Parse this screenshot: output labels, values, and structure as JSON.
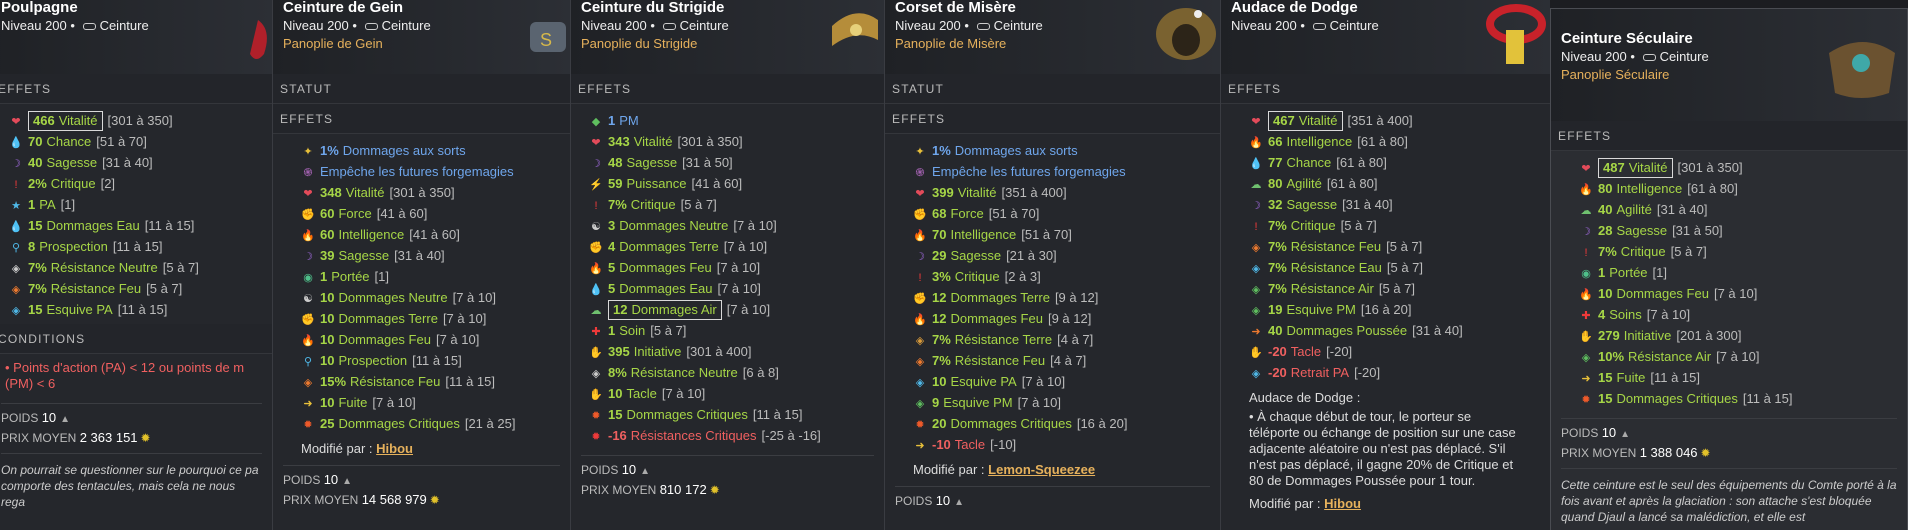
{
  "panels": [
    {
      "name": "Poulpagne",
      "level": "Niveau 200",
      "type": "Ceinture",
      "effects_label": "EFFETS",
      "effects": [
        {
          "i": "❤",
          "c": "#e34b5a",
          "v": "466",
          "t": "Vitalité",
          "r": "[301 à 350]",
          "box": true,
          "cl": "g"
        },
        {
          "i": "💧",
          "c": "#56b3ea",
          "v": "70",
          "t": "Chance",
          "r": "[51 à 70]",
          "cl": "g"
        },
        {
          "i": "☽",
          "c": "#a26be0",
          "v": "40",
          "t": "Sagesse",
          "r": "[31 à 40]",
          "cl": "g"
        },
        {
          "i": "!",
          "c": "#ef3a3a",
          "v": "2%",
          "t": "Critique",
          "r": "[2]",
          "cl": "g"
        },
        {
          "i": "★",
          "c": "#4fb8e8",
          "v": "1",
          "t": "PA",
          "r": "[1]",
          "cl": "g"
        },
        {
          "i": "💧",
          "c": "#56b3ea",
          "v": "15",
          "t": "Dommages Eau",
          "r": "[11 à 15]",
          "cl": "g"
        },
        {
          "i": "⚲",
          "c": "#4fb8e8",
          "v": "8",
          "t": "Prospection",
          "r": "[11 à 15]",
          "cl": "g"
        },
        {
          "i": "◈",
          "c": "#ccc",
          "v": "7%",
          "t": "Résistance Neutre",
          "r": "[5 à 7]",
          "cl": "g"
        },
        {
          "i": "◈",
          "c": "#ee7a2f",
          "v": "7%",
          "t": "Résistance Feu",
          "r": "[5 à 7]",
          "cl": "g"
        },
        {
          "i": "◈",
          "c": "#4fb8e8",
          "v": "15",
          "t": "Esquive PA",
          "r": "[11 à 15]",
          "cl": "g"
        }
      ],
      "conditions_label": "CONDITIONS",
      "conditions": "• Points d'action (PA) < 12 ou points de m (PM) < 6",
      "weight_label": "POIDS",
      "weight": "10",
      "price_label": "PRIX MOYEN",
      "price": "2 363 151",
      "description": "On pourrait se questionner sur le pourquoi ce pa comporte des tentacules, mais cela ne nous rega"
    },
    {
      "name": "Ceinture de Gein",
      "level": "Niveau 200",
      "type": "Ceinture",
      "set": "Panoplie de Gein",
      "status_label": "STATUT",
      "effects_label": "EFFETS",
      "effects": [
        {
          "i": "✦",
          "c": "#e8c03a",
          "v": "1%",
          "t": "Dommages aux sorts",
          "cl": "b"
        },
        {
          "i": "֍",
          "c": "#c070d0",
          "v": "",
          "t": "Empêche les futures forgemagies",
          "cl": "b"
        },
        {
          "i": "❤",
          "c": "#e34b5a",
          "v": "348",
          "t": "Vitalité",
          "r": "[301 à 350]",
          "cl": "g"
        },
        {
          "i": "✊",
          "c": "#d89a3a",
          "v": "60",
          "t": "Force",
          "r": "[41 à 60]",
          "cl": "g"
        },
        {
          "i": "🔥",
          "c": "#ee7a2f",
          "v": "60",
          "t": "Intelligence",
          "r": "[41 à 60]",
          "cl": "g"
        },
        {
          "i": "☽",
          "c": "#a26be0",
          "v": "39",
          "t": "Sagesse",
          "r": "[31 à 40]",
          "cl": "g"
        },
        {
          "i": "◉",
          "c": "#4fc08a",
          "v": "1",
          "t": "Portée",
          "r": "[1]",
          "cl": "g"
        },
        {
          "i": "☯",
          "c": "#ccc",
          "v": "10",
          "t": "Dommages Neutre",
          "r": "[7 à 10]",
          "cl": "g"
        },
        {
          "i": "✊",
          "c": "#d89a3a",
          "v": "10",
          "t": "Dommages Terre",
          "r": "[7 à 10]",
          "cl": "g"
        },
        {
          "i": "🔥",
          "c": "#ee7a2f",
          "v": "10",
          "t": "Dommages Feu",
          "r": "[7 à 10]",
          "cl": "g"
        },
        {
          "i": "⚲",
          "c": "#4fb8e8",
          "v": "10",
          "t": "Prospection",
          "r": "[11 à 15]",
          "cl": "g"
        },
        {
          "i": "◈",
          "c": "#ee7a2f",
          "v": "15%",
          "t": "Résistance Feu",
          "r": "[11 à 15]",
          "cl": "g"
        },
        {
          "i": "➜",
          "c": "#e8c03a",
          "v": "10",
          "t": "Fuite",
          "r": "[7 à 10]",
          "cl": "g"
        },
        {
          "i": "✹",
          "c": "#ef5a2a",
          "v": "25",
          "t": "Dommages Critiques",
          "r": "[21 à 25]",
          "cl": "g"
        }
      ],
      "modified_label": "Modifié par :",
      "modified_by": "Hibou",
      "weight_label": "POIDS",
      "weight": "10",
      "price_label": "PRIX MOYEN",
      "price": "14 568 979"
    },
    {
      "name": "Ceinture du Strigide",
      "level": "Niveau 200",
      "type": "Ceinture",
      "set": "Panoplie du Strigide",
      "effects_label": "EFFETS",
      "effects": [
        {
          "i": "◆",
          "c": "#5fbf5f",
          "v": "1",
          "t": "PM",
          "cl": "b"
        },
        {
          "i": "❤",
          "c": "#e34b5a",
          "v": "343",
          "t": "Vitalité",
          "r": "[301 à 350]",
          "cl": "g"
        },
        {
          "i": "☽",
          "c": "#a26be0",
          "v": "48",
          "t": "Sagesse",
          "r": "[31 à 50]",
          "cl": "g"
        },
        {
          "i": "⚡",
          "c": "#e8c03a",
          "v": "59",
          "t": "Puissance",
          "r": "[41 à 60]",
          "cl": "g"
        },
        {
          "i": "!",
          "c": "#ef3a3a",
          "v": "7%",
          "t": "Critique",
          "r": "[5 à 7]",
          "cl": "g"
        },
        {
          "i": "☯",
          "c": "#ccc",
          "v": "3",
          "t": "Dommages Neutre",
          "r": "[7 à 10]",
          "cl": "g"
        },
        {
          "i": "✊",
          "c": "#d89a3a",
          "v": "4",
          "t": "Dommages Terre",
          "r": "[7 à 10]",
          "cl": "g"
        },
        {
          "i": "🔥",
          "c": "#ee7a2f",
          "v": "5",
          "t": "Dommages Feu",
          "r": "[7 à 10]",
          "cl": "g"
        },
        {
          "i": "💧",
          "c": "#56b3ea",
          "v": "5",
          "t": "Dommages Eau",
          "r": "[7 à 10]",
          "cl": "g"
        },
        {
          "i": "☁",
          "c": "#6fc06f",
          "v": "12",
          "t": "Dommages Air",
          "r": "[7 à 10]",
          "box": true,
          "cl": "g"
        },
        {
          "i": "✚",
          "c": "#ef3a3a",
          "v": "1",
          "t": "Soin",
          "r": "[5 à 7]",
          "cl": "g"
        },
        {
          "i": "✋",
          "c": "#c070d0",
          "v": "395",
          "t": "Initiative",
          "r": "[301 à 400]",
          "cl": "g"
        },
        {
          "i": "◈",
          "c": "#ccc",
          "v": "8%",
          "t": "Résistance Neutre",
          "r": "[6 à 8]",
          "cl": "g"
        },
        {
          "i": "✋",
          "c": "#ccc",
          "v": "10",
          "t": "Tacle",
          "r": "[7 à 10]",
          "cl": "g"
        },
        {
          "i": "✹",
          "c": "#ef5a2a",
          "v": "15",
          "t": "Dommages Critiques",
          "r": "[11 à 15]",
          "cl": "g"
        },
        {
          "i": "✹",
          "c": "#ef3a3a",
          "v": "-16",
          "t": "Résistances Critiques",
          "r": "[-25 à -16]",
          "cl": "r"
        }
      ],
      "weight_label": "POIDS",
      "weight": "10",
      "price_label": "PRIX MOYEN",
      "price": "810 172"
    },
    {
      "name": "Corset de Misère",
      "level": "Niveau 200",
      "type": "Ceinture",
      "set": "Panoplie de Misère",
      "status_label": "STATUT",
      "effects_label": "EFFETS",
      "effects": [
        {
          "i": "✦",
          "c": "#e8c03a",
          "v": "1%",
          "t": "Dommages aux sorts",
          "cl": "b"
        },
        {
          "i": "֍",
          "c": "#c070d0",
          "v": "",
          "t": "Empêche les futures forgemagies",
          "cl": "b"
        },
        {
          "i": "❤",
          "c": "#e34b5a",
          "v": "399",
          "t": "Vitalité",
          "r": "[351 à 400]",
          "cl": "g"
        },
        {
          "i": "✊",
          "c": "#d89a3a",
          "v": "68",
          "t": "Force",
          "r": "[51 à 70]",
          "cl": "g"
        },
        {
          "i": "🔥",
          "c": "#ee7a2f",
          "v": "70",
          "t": "Intelligence",
          "r": "[51 à 70]",
          "cl": "g"
        },
        {
          "i": "☽",
          "c": "#a26be0",
          "v": "29",
          "t": "Sagesse",
          "r": "[21 à 30]",
          "cl": "g"
        },
        {
          "i": "!",
          "c": "#ef3a3a",
          "v": "3%",
          "t": "Critique",
          "r": "[2 à 3]",
          "cl": "g"
        },
        {
          "i": "✊",
          "c": "#d89a3a",
          "v": "12",
          "t": "Dommages Terre",
          "r": "[9 à 12]",
          "cl": "g"
        },
        {
          "i": "🔥",
          "c": "#ee7a2f",
          "v": "12",
          "t": "Dommages Feu",
          "r": "[9 à 12]",
          "cl": "g"
        },
        {
          "i": "◈",
          "c": "#d89a3a",
          "v": "7%",
          "t": "Résistance Terre",
          "r": "[4 à 7]",
          "cl": "g"
        },
        {
          "i": "◈",
          "c": "#ee7a2f",
          "v": "7%",
          "t": "Résistance Feu",
          "r": "[4 à 7]",
          "cl": "g"
        },
        {
          "i": "◈",
          "c": "#4fb8e8",
          "v": "10",
          "t": "Esquive PA",
          "r": "[7 à 10]",
          "cl": "g"
        },
        {
          "i": "◈",
          "c": "#5fbf5f",
          "v": "9",
          "t": "Esquive PM",
          "r": "[7 à 10]",
          "cl": "g"
        },
        {
          "i": "✹",
          "c": "#ef5a2a",
          "v": "20",
          "t": "Dommages Critiques",
          "r": "[16 à 20]",
          "cl": "g"
        },
        {
          "i": "➜",
          "c": "#e8c03a",
          "v": "-10",
          "t": "Tacle",
          "r": "[-10]",
          "cl": "r"
        }
      ],
      "modified_label": "Modifié par :",
      "modified_by": "Lemon-Squeezee",
      "weight_label": "POIDS",
      "weight": "10"
    },
    {
      "name": "Audace de Dodge",
      "level": "Niveau 200",
      "type": "Ceinture",
      "effects_label": "EFFETS",
      "effects": [
        {
          "i": "❤",
          "c": "#e34b5a",
          "v": "467",
          "t": "Vitalité",
          "r": "[351 à 400]",
          "box": true,
          "cl": "g"
        },
        {
          "i": "🔥",
          "c": "#ee7a2f",
          "v": "66",
          "t": "Intelligence",
          "r": "[61 à 80]",
          "cl": "g"
        },
        {
          "i": "💧",
          "c": "#56b3ea",
          "v": "77",
          "t": "Chance",
          "r": "[61 à 80]",
          "cl": "g"
        },
        {
          "i": "☁",
          "c": "#6fc06f",
          "v": "80",
          "t": "Agilité",
          "r": "[61 à 80]",
          "cl": "g"
        },
        {
          "i": "☽",
          "c": "#a26be0",
          "v": "32",
          "t": "Sagesse",
          "r": "[31 à 40]",
          "cl": "g"
        },
        {
          "i": "!",
          "c": "#ef3a3a",
          "v": "7%",
          "t": "Critique",
          "r": "[5 à 7]",
          "cl": "g"
        },
        {
          "i": "◈",
          "c": "#ee7a2f",
          "v": "7%",
          "t": "Résistance Feu",
          "r": "[5 à 7]",
          "cl": "g"
        },
        {
          "i": "◈",
          "c": "#4fb8e8",
          "v": "7%",
          "t": "Résistance Eau",
          "r": "[5 à 7]",
          "cl": "g"
        },
        {
          "i": "◈",
          "c": "#5fbf5f",
          "v": "7%",
          "t": "Résistance Air",
          "r": "[5 à 7]",
          "cl": "g"
        },
        {
          "i": "◈",
          "c": "#5fbf5f",
          "v": "19",
          "t": "Esquive PM",
          "r": "[16 à 20]",
          "cl": "g"
        },
        {
          "i": "➜",
          "c": "#ee7a2f",
          "v": "40",
          "t": "Dommages Poussée",
          "r": "[31 à 40]",
          "cl": "g"
        },
        {
          "i": "✋",
          "c": "#ef5a2a",
          "v": "-20",
          "t": "Tacle",
          "r": "[-20]",
          "cl": "r"
        },
        {
          "i": "◈",
          "c": "#4fb8e8",
          "v": "-20",
          "t": "Retrait PA",
          "r": "[-20]",
          "cl": "r"
        }
      ],
      "extra_title": "Audace de Dodge :",
      "extra": "• À chaque début de tour, le porteur se téléporte ou échange de position sur une case adjacente aléatoire ou n'est pas déplacé. S'il n'est pas déplacé, il gagne 20% de Critique et 80 de Dommages Poussée pour 1 tour.",
      "modified_label": "Modifié par :",
      "modified_by": "Hibou"
    },
    {
      "name": "Ceinture Séculaire",
      "level": "Niveau 200",
      "type": "Ceinture",
      "set": "Panoplie Séculaire",
      "effects_label": "EFFETS",
      "effects": [
        {
          "i": "❤",
          "c": "#e34b5a",
          "v": "487",
          "t": "Vitalité",
          "r": "[301 à 350]",
          "box": true,
          "cl": "g"
        },
        {
          "i": "🔥",
          "c": "#ee7a2f",
          "v": "80",
          "t": "Intelligence",
          "r": "[61 à 80]",
          "cl": "g"
        },
        {
          "i": "☁",
          "c": "#6fc06f",
          "v": "40",
          "t": "Agilité",
          "r": "[31 à 40]",
          "cl": "g"
        },
        {
          "i": "☽",
          "c": "#a26be0",
          "v": "28",
          "t": "Sagesse",
          "r": "[31 à 50]",
          "cl": "g"
        },
        {
          "i": "!",
          "c": "#ef3a3a",
          "v": "7%",
          "t": "Critique",
          "r": "[5 à 7]",
          "cl": "g"
        },
        {
          "i": "◉",
          "c": "#4fc08a",
          "v": "1",
          "t": "Portée",
          "r": "[1]",
          "cl": "g"
        },
        {
          "i": "🔥",
          "c": "#ee7a2f",
          "v": "10",
          "t": "Dommages Feu",
          "r": "[7 à 10]",
          "cl": "g"
        },
        {
          "i": "✚",
          "c": "#ef3a3a",
          "v": "4",
          "t": "Soins",
          "r": "[7 à 10]",
          "cl": "g"
        },
        {
          "i": "✋",
          "c": "#c070d0",
          "v": "279",
          "t": "Initiative",
          "r": "[201 à 300]",
          "cl": "g"
        },
        {
          "i": "◈",
          "c": "#5fbf5f",
          "v": "10%",
          "t": "Résistance Air",
          "r": "[7 à 10]",
          "cl": "g"
        },
        {
          "i": "➜",
          "c": "#e8c03a",
          "v": "15",
          "t": "Fuite",
          "r": "[11 à 15]",
          "cl": "g"
        },
        {
          "i": "✹",
          "c": "#ef5a2a",
          "v": "15",
          "t": "Dommages Critiques",
          "r": "[11 à 15]",
          "cl": "g"
        }
      ],
      "weight_label": "POIDS",
      "weight": "10",
      "price_label": "PRIX MOYEN",
      "price": "1 388 046",
      "description": "Cette ceinture est le seul des équipements du Comte porté à la fois avant et après la glaciation : son attache s'est bloquée quand Djaul a lancé sa malédiction, et elle est"
    }
  ]
}
